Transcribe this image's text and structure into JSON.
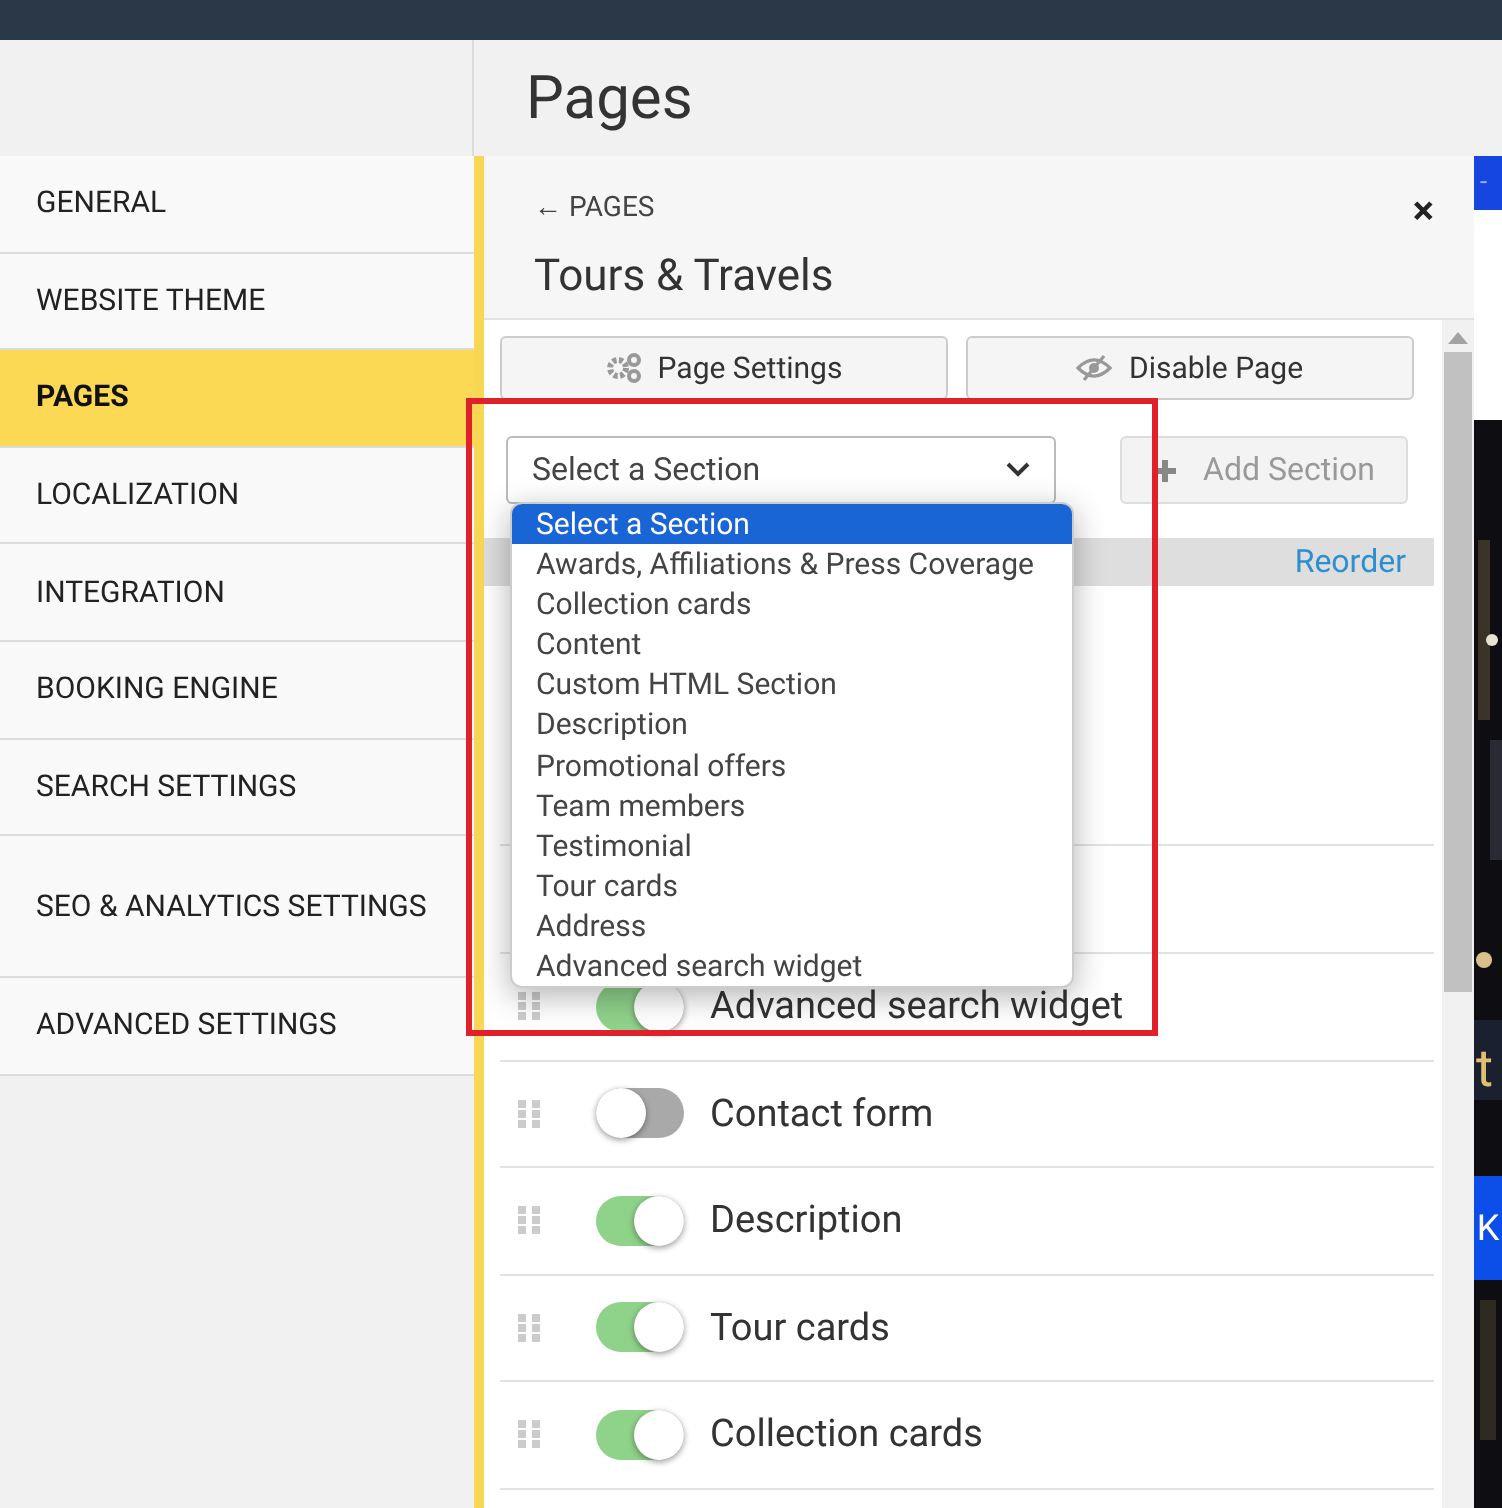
{
  "page_title": "Pages",
  "sidebar": {
    "items": [
      {
        "label": "GENERAL",
        "selected": false
      },
      {
        "label": "WEBSITE THEME",
        "selected": false
      },
      {
        "label": "PAGES",
        "selected": true
      },
      {
        "label": "LOCALIZATION",
        "selected": false
      },
      {
        "label": "INTEGRATION",
        "selected": false
      },
      {
        "label": "BOOKING ENGINE",
        "selected": false
      },
      {
        "label": "SEARCH SETTINGS",
        "selected": false
      },
      {
        "label": "SEO & ANALYTICS SETTINGS",
        "selected": false
      },
      {
        "label": "ADVANCED SETTINGS",
        "selected": false
      }
    ]
  },
  "panel": {
    "back_link": "← PAGES",
    "close": "×",
    "title": "Tours & Travels",
    "buttons": [
      "Page Settings",
      "Disable Page"
    ],
    "section_select": {
      "value": "Select a Section",
      "expanded": true
    },
    "add_button": {
      "label": "Add Section",
      "disabled": true
    },
    "reorder_link": "Reorder",
    "dropdown_options": [
      {
        "label": "Select a Section",
        "selected": true
      },
      {
        "label": "Awards, Affiliations & Press Coverage",
        "selected": false
      },
      {
        "label": "Collection cards",
        "selected": false
      },
      {
        "label": "Content",
        "selected": false
      },
      {
        "label": "Custom HTML Section",
        "selected": false
      },
      {
        "label": "Description",
        "selected": false
      },
      {
        "label": "Promotional offers",
        "selected": false
      },
      {
        "label": "Team members",
        "selected": false
      },
      {
        "label": "Testimonial",
        "selected": false
      },
      {
        "label": "Tour cards",
        "selected": false
      },
      {
        "label": "Address",
        "selected": false
      },
      {
        "label": "Advanced search widget",
        "selected": false
      }
    ],
    "sections": [
      {
        "label": "Advanced search widget",
        "on": true
      },
      {
        "label": "Contact form",
        "on": false
      },
      {
        "label": "Description",
        "on": true
      },
      {
        "label": "Tour cards",
        "on": true
      },
      {
        "label": "Collection cards",
        "on": true
      }
    ]
  },
  "preview": {
    "texts": [
      "-",
      "t",
      "K"
    ]
  }
}
